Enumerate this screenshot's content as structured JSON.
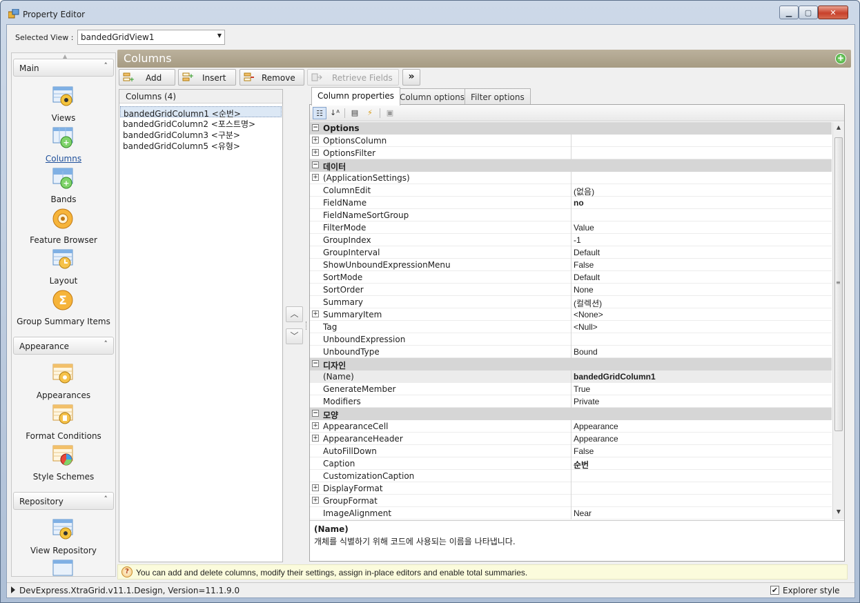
{
  "window": {
    "title": "Property Editor"
  },
  "selected_view": {
    "label": "Selected View :",
    "value": "bandedGridView1"
  },
  "nav": {
    "groups": [
      {
        "label": "Main",
        "items": [
          {
            "label": "Views",
            "icon": "views-icon"
          },
          {
            "label": "Columns",
            "icon": "columns-icon",
            "active": true
          },
          {
            "label": "Bands",
            "icon": "bands-icon"
          },
          {
            "label": "Feature Browser",
            "icon": "feature-browser-icon"
          },
          {
            "label": "Layout",
            "icon": "layout-icon"
          },
          {
            "label": "Group Summary Items",
            "icon": "sigma-icon"
          }
        ]
      },
      {
        "label": "Appearance",
        "items": [
          {
            "label": "Appearances",
            "icon": "appearances-icon"
          },
          {
            "label": "Format Conditions",
            "icon": "format-conditions-icon"
          },
          {
            "label": "Style Schemes",
            "icon": "style-schemes-icon"
          }
        ]
      },
      {
        "label": "Repository",
        "items": [
          {
            "label": "View Repository",
            "icon": "view-repository-icon"
          }
        ]
      }
    ]
  },
  "page": {
    "title": "Columns"
  },
  "toolbar": {
    "add": "Add",
    "insert": "Insert",
    "remove": "Remove",
    "retrieve": "Retrieve Fields",
    "more": "»"
  },
  "columns": {
    "header": "Columns (4)",
    "items": [
      "bandedGridColumn1 <순번>",
      "bandedGridColumn2 <포스트명>",
      "bandedGridColumn3 <구분>",
      "bandedGridColumn5 <유형>"
    ]
  },
  "tabs": [
    "Column properties",
    "Column options",
    "Filter options"
  ],
  "properties": [
    {
      "type": "cat",
      "name": "Options"
    },
    {
      "type": "prop",
      "expand": true,
      "name": "OptionsColumn",
      "value": ""
    },
    {
      "type": "prop",
      "expand": true,
      "name": "OptionsFilter",
      "value": ""
    },
    {
      "type": "cat",
      "name": "데이터"
    },
    {
      "type": "prop",
      "expand": true,
      "name": "(ApplicationSettings)",
      "value": ""
    },
    {
      "type": "prop",
      "name": "ColumnEdit",
      "value": "(없음)"
    },
    {
      "type": "prop",
      "name": "FieldName",
      "value": "no",
      "bold": true
    },
    {
      "type": "prop",
      "name": "FieldNameSortGroup",
      "value": ""
    },
    {
      "type": "prop",
      "name": "FilterMode",
      "value": "Value"
    },
    {
      "type": "prop",
      "name": "GroupIndex",
      "value": "-1"
    },
    {
      "type": "prop",
      "name": "GroupInterval",
      "value": "Default"
    },
    {
      "type": "prop",
      "name": "ShowUnboundExpressionMenu",
      "value": "False"
    },
    {
      "type": "prop",
      "name": "SortMode",
      "value": "Default"
    },
    {
      "type": "prop",
      "name": "SortOrder",
      "value": "None"
    },
    {
      "type": "prop",
      "name": "Summary",
      "value": "(컬렉션)"
    },
    {
      "type": "prop",
      "expand": true,
      "name": "SummaryItem",
      "value": "<None>"
    },
    {
      "type": "prop",
      "name": "Tag",
      "value": "<Null>"
    },
    {
      "type": "prop",
      "name": "UnboundExpression",
      "value": ""
    },
    {
      "type": "prop",
      "name": "UnboundType",
      "value": "Bound"
    },
    {
      "type": "cat",
      "name": "디자인"
    },
    {
      "type": "prop",
      "name": "(Name)",
      "value": "bandedGridColumn1",
      "bold": true,
      "selected": true
    },
    {
      "type": "prop",
      "name": "GenerateMember",
      "value": "True"
    },
    {
      "type": "prop",
      "name": "Modifiers",
      "value": "Private"
    },
    {
      "type": "cat",
      "name": "모양"
    },
    {
      "type": "prop",
      "expand": true,
      "name": "AppearanceCell",
      "value": "Appearance"
    },
    {
      "type": "prop",
      "expand": true,
      "name": "AppearanceHeader",
      "value": "Appearance"
    },
    {
      "type": "prop",
      "name": "AutoFillDown",
      "value": "False"
    },
    {
      "type": "prop",
      "name": "Caption",
      "value": "순번",
      "bold": true
    },
    {
      "type": "prop",
      "name": "CustomizationCaption",
      "value": ""
    },
    {
      "type": "prop",
      "expand": true,
      "name": "DisplayFormat",
      "value": ""
    },
    {
      "type": "prop",
      "expand": true,
      "name": "GroupFormat",
      "value": ""
    },
    {
      "type": "prop",
      "name": "ImageAlignment",
      "value": "Near"
    }
  ],
  "description": {
    "title": "(Name)",
    "text": "개체를 식별하기 위해 코드에 사용되는 이름을 나타냅니다."
  },
  "hint": {
    "text": "You can add and delete columns, modify their settings, assign in-place editors and enable total summaries."
  },
  "status": {
    "text": "DevExpress.XtraGrid.v11.1.Design, Version=11.1.9.0",
    "explorer_label": "Explorer style",
    "explorer_checked": true
  },
  "colors": {
    "header_bar": "#a69b83",
    "accent_blue": "#1e4f9a",
    "hint_bg": "#fbfbdc"
  }
}
